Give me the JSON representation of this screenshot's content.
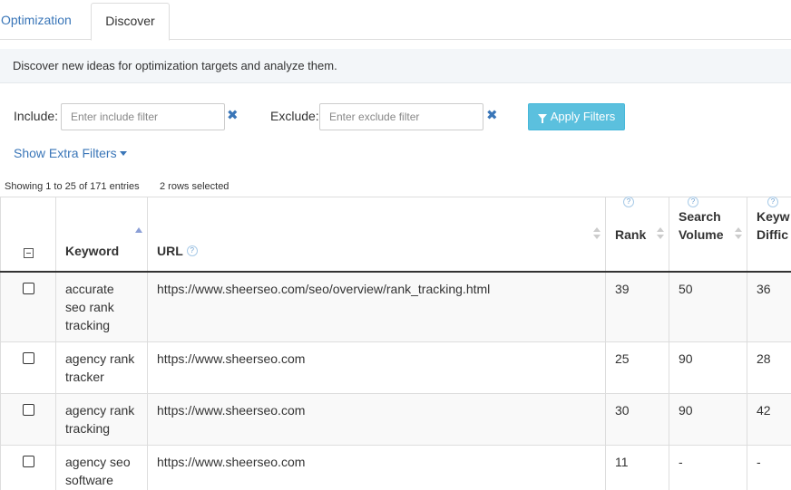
{
  "tabs": [
    {
      "label": "Optimization",
      "active": false
    },
    {
      "label": "Discover",
      "active": true
    }
  ],
  "info": "Discover new ideas for optimization targets and analyze them.",
  "filters": {
    "include_label": "Include:",
    "include_placeholder": "Enter include filter",
    "include_value": "",
    "exclude_label": "Exclude:",
    "exclude_placeholder": "Enter exclude filter",
    "exclude_value": "",
    "apply_label": "Apply Filters",
    "extra_label": "Show Extra Filters"
  },
  "status": {
    "showing": "Showing 1 to 25 of 171 entries",
    "selected": "2 rows selected"
  },
  "table": {
    "columns": {
      "keyword": "Keyword",
      "url": "URL",
      "rank": "Rank",
      "sv1": "Search",
      "sv2": "Volume",
      "kd1": "Keyw",
      "kd2": "Diffic"
    },
    "help": "?",
    "rows": [
      {
        "keyword": "accurate seo rank tracking",
        "url": "https://www.sheerseo.com/seo/overview/rank_tracking.html",
        "rank": "39",
        "volume": "50",
        "difficulty": "36"
      },
      {
        "keyword": "agency rank tracker",
        "url": "https://www.sheerseo.com",
        "rank": "25",
        "volume": "90",
        "difficulty": "28"
      },
      {
        "keyword": "agency rank tracking",
        "url": "https://www.sheerseo.com",
        "rank": "30",
        "volume": "90",
        "difficulty": "42"
      },
      {
        "keyword": "agency seo software",
        "url": "https://www.sheerseo.com",
        "rank": "11",
        "volume": "-",
        "difficulty": "-"
      }
    ]
  },
  "colors": {
    "link": "#3a76b8",
    "button": "#5bc0de",
    "info_bg": "#f3f6f9"
  }
}
